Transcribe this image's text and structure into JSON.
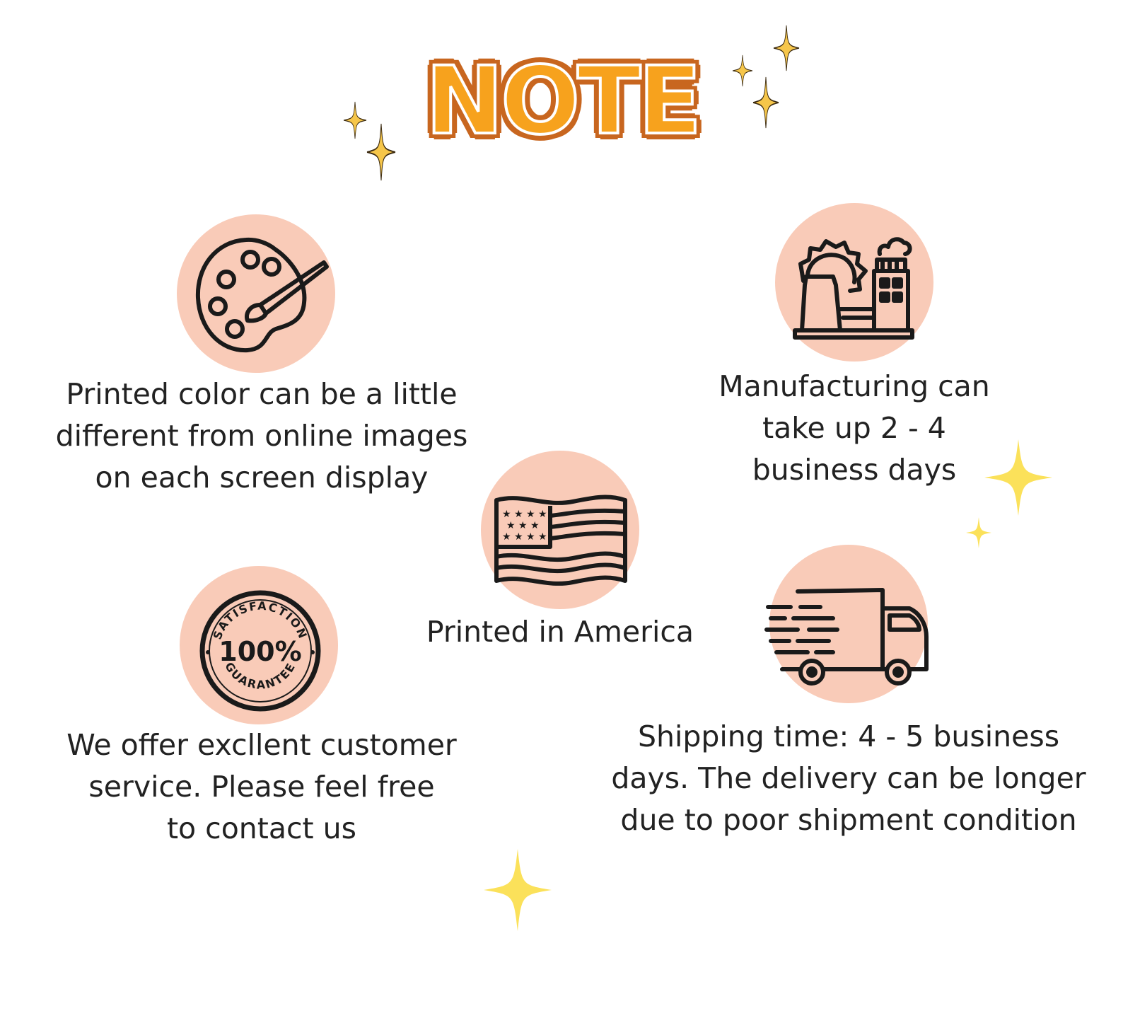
{
  "colors": {
    "background": "#ffffff",
    "circle_fill": "#f9cbb8",
    "icon_stroke": "#1a1a1a",
    "sparkle": "#fbe052",
    "title_orange": "#f7a21d",
    "title_outline": "#c8661f"
  },
  "title": "NOTE",
  "notes": [
    {
      "icon": "palette-icon",
      "text": "Printed color can be a little\ndifferent from online images\non each screen display"
    },
    {
      "icon": "factory-icon",
      "text": "Manufacturing can\ntake up 2 - 4\nbusiness days"
    },
    {
      "icon": "us-flag-icon",
      "text": "Printed in America"
    },
    {
      "icon": "satisfaction-guarantee-badge-icon",
      "text": "We offer excllent customer\nservice. Please feel free\nto contact us",
      "badge": {
        "top_text": "SATISFACTION",
        "center_text": "100%",
        "bottom_text": "GUARANTEE"
      }
    },
    {
      "icon": "delivery-truck-icon",
      "text": "Shipping time: 4 - 5 business\ndays. The delivery can be longer\ndue to poor shipment condition"
    }
  ]
}
